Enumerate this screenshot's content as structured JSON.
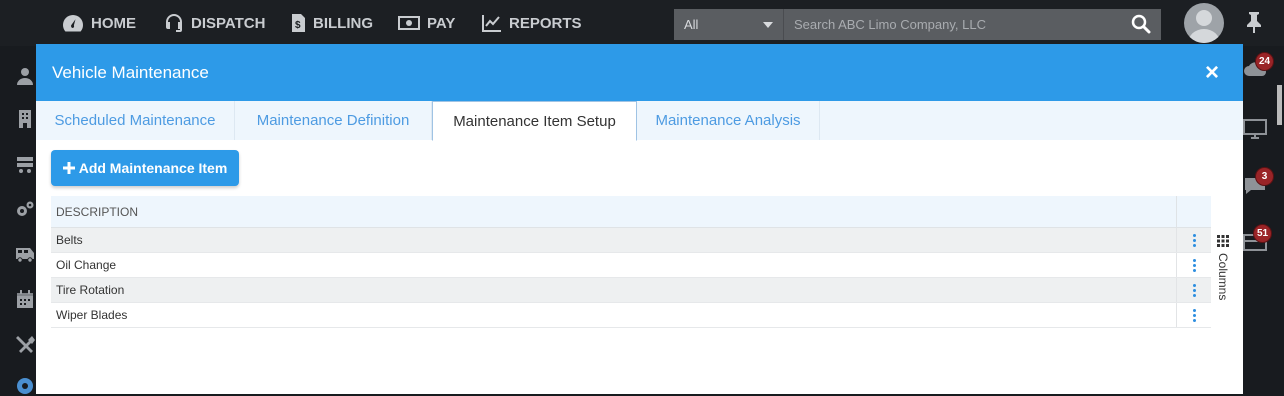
{
  "nav": {
    "items": [
      {
        "label": "HOME",
        "icon": "dashboard-icon"
      },
      {
        "label": "DISPATCH",
        "icon": "headset-icon"
      },
      {
        "label": "BILLING",
        "icon": "invoice-icon"
      },
      {
        "label": "PAY",
        "icon": "money-icon"
      },
      {
        "label": "REPORTS",
        "icon": "chart-line-icon"
      }
    ]
  },
  "search": {
    "scope": "All",
    "placeholder": "Search ABC Limo Company, LLC",
    "value": ""
  },
  "right_rail": {
    "badges": {
      "cloud": "24",
      "chat": "3",
      "inbox": "51"
    }
  },
  "modal": {
    "title": "Vehicle Maintenance",
    "close_label": "×",
    "tabs": [
      {
        "label": "Scheduled Maintenance",
        "active": false
      },
      {
        "label": "Maintenance Definition",
        "active": false
      },
      {
        "label": "Maintenance Item Setup",
        "active": true
      },
      {
        "label": "Maintenance Analysis",
        "active": false
      }
    ],
    "add_button_label": "Add Maintenance Item",
    "grid": {
      "column_header": "DESCRIPTION",
      "rows": [
        "Belts",
        "Oil Change",
        "Tire Rotation",
        "Wiper Blades"
      ]
    },
    "columns_toggle_label": "Columns"
  },
  "colors": {
    "accent": "#2d9ae8",
    "topbar": "#1c1f23",
    "badge": "#9a2427"
  }
}
